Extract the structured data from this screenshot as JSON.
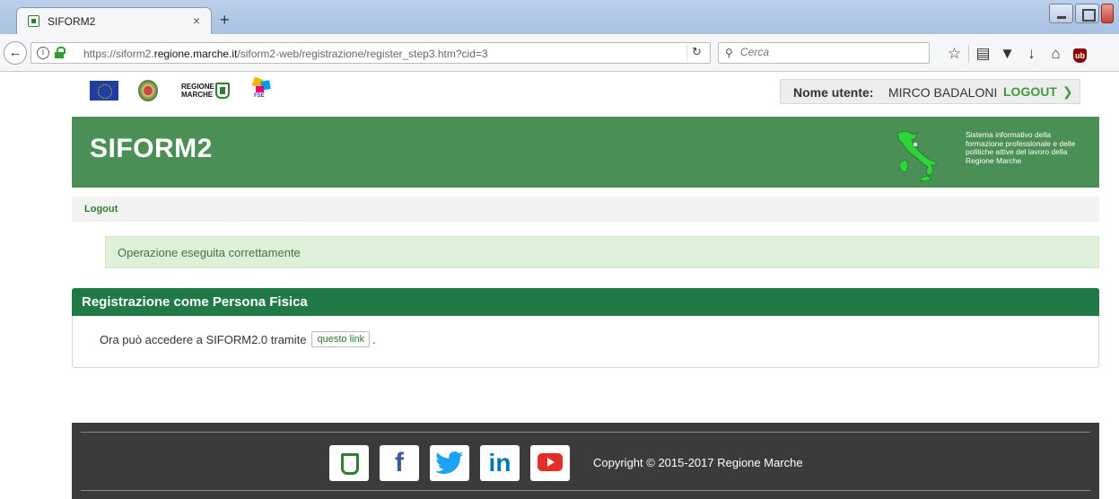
{
  "browser": {
    "tab_title": "SIFORM2",
    "tab_close": "×",
    "new_tab": "+",
    "url_host_pre": "https://siform2.",
    "url_host_main": "regione.marche.it",
    "url_path": "/siform2-web/registrazione/register_step3.htm?cid=3",
    "search_placeholder": "Cerca"
  },
  "header": {
    "user_label": "Nome utente:",
    "user_name": "MIRCO BADALONI",
    "logout_label": "LOGOUT",
    "marche_logo_text": "REGIONE MARCHE",
    "fse_logo_text": "FSE"
  },
  "banner": {
    "title": "SIFORM2",
    "tagline": "Sistema informativo della formazione professionale e delle politiche attive del lavoro della Regione Marche"
  },
  "subnav": {
    "logout_link": "Logout"
  },
  "alert": {
    "message": "Operazione eseguita correttamente"
  },
  "panel": {
    "title": "Registrazione come Persona Fisica",
    "body_text": "Ora può accedere a SIFORM2.0 tramite",
    "link_label": "questo link",
    "body_suffix": "."
  },
  "footer": {
    "copyright": "Copyright © 2015-2017 Regione Marche"
  },
  "colors": {
    "banner_green": "#4a8f55",
    "panel_header": "#1f7a45",
    "link_green": "#3f9a3f",
    "footer_bg": "#3b3b3b"
  }
}
